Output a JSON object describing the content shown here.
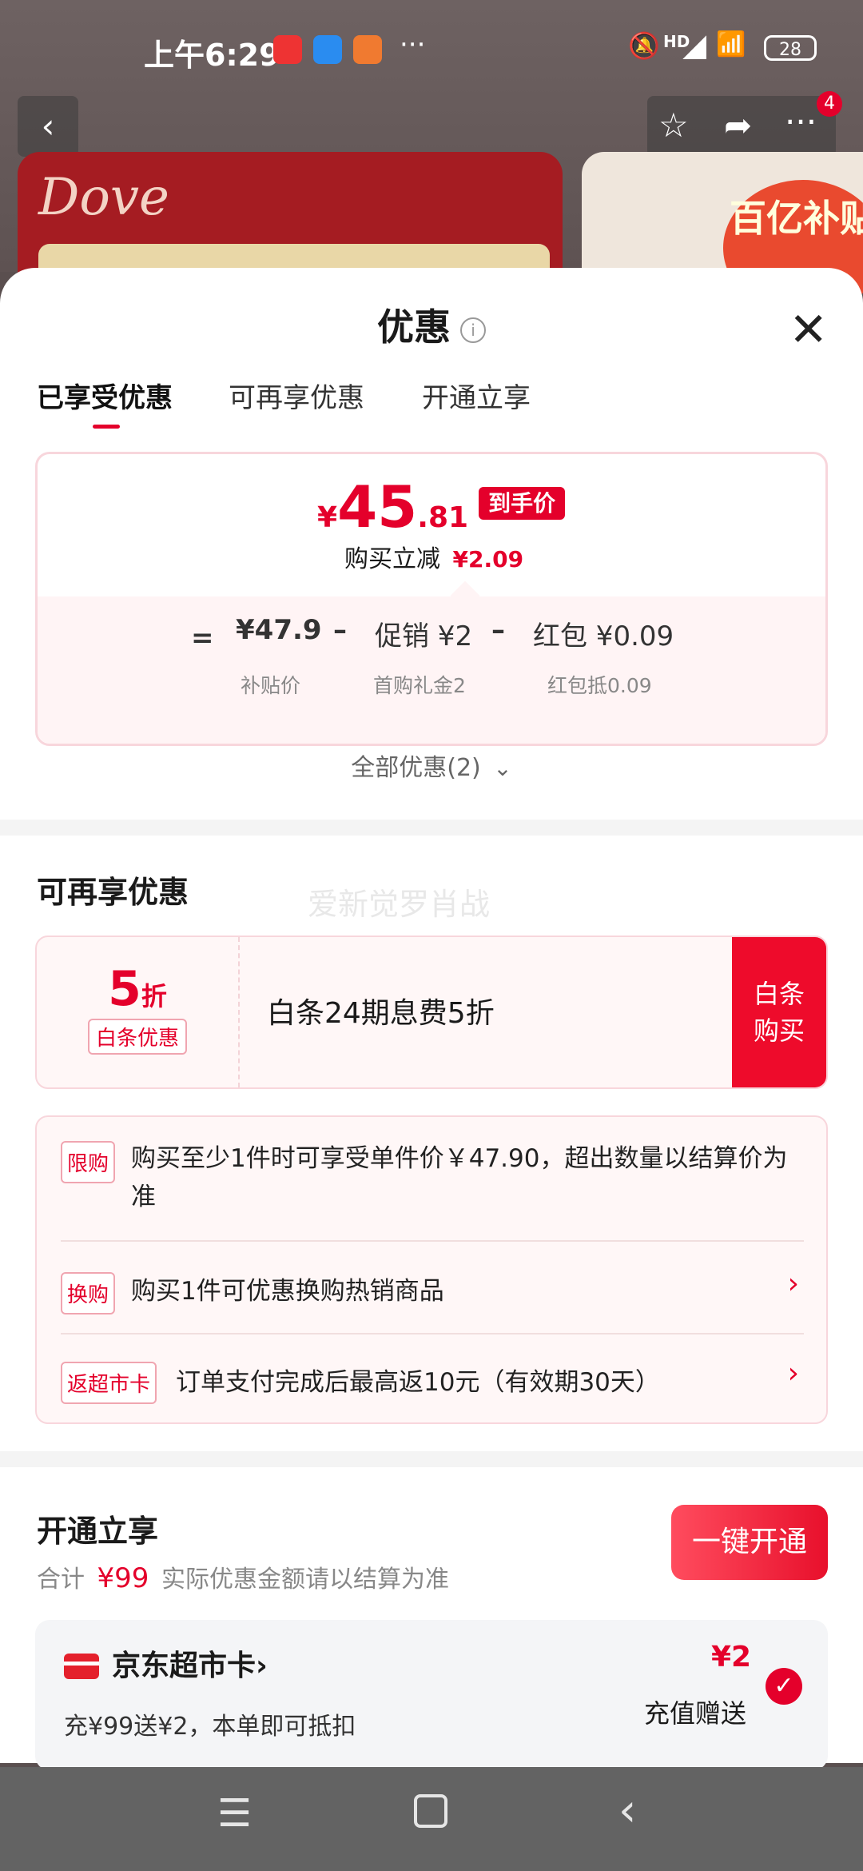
{
  "status_bar": {
    "time": "上午6:29",
    "battery": "28",
    "network": "HD"
  },
  "sheet": {
    "title": "优惠",
    "info_icon": "i",
    "close_icon": "✕",
    "tabs": [
      {
        "label": "已享受优惠",
        "active": true
      },
      {
        "label": "可再享优惠",
        "active": false
      },
      {
        "label": "开通立享",
        "active": false
      }
    ]
  },
  "price_card": {
    "currency": "¥",
    "price_int": "45",
    "price_dec": ".81",
    "price_tag": "到手价",
    "instant_label": "购买立减",
    "instant_amount": "¥2.09",
    "eq": "=",
    "minus": "–",
    "subsidy_value": "¥47.9",
    "subsidy_label": "补贴价",
    "promo_value": "促销 ¥2",
    "promo_label": "首购礼金2",
    "redpacket_value": "红包 ¥0.09",
    "redpacket_label": "红包抵0.09"
  },
  "all_discounts": "全部优惠(2)",
  "more_section": {
    "title": "可再享优惠",
    "watermark": "爱新觉罗肖战",
    "coupon": {
      "discount_num": "5",
      "discount_unit": "折",
      "badge": "白条优惠",
      "desc": "白条24期息费5折",
      "button_line1": "白条",
      "button_line2": "购买"
    },
    "rules": [
      {
        "badge": "限购",
        "text": "购买至少1件时可享受单件价￥47.90，超出数量以结算价为准"
      },
      {
        "badge": "换购",
        "text": "购买1件可优惠换购热销商品"
      },
      {
        "badge": "返超市卡",
        "text": "订单支付完成后最高返10元（有效期30天）"
      }
    ]
  },
  "open_section": {
    "title": "开通立享",
    "total_label": "合计",
    "total_amount": "¥99",
    "total_note": "实际优惠金额请以结算为准",
    "button": "一键开通",
    "card": {
      "name": "京东超市卡",
      "name_chevron": "›",
      "desc": "充¥99送¥2，本单即可抵扣",
      "gift_amount": "¥2",
      "gift_label": "充值赠送"
    }
  },
  "background": {
    "brand_logo": "Dove",
    "subsidy_badge": "百亿补贴",
    "notification_count": "4"
  },
  "colors": {
    "accent": "#e4002b"
  }
}
